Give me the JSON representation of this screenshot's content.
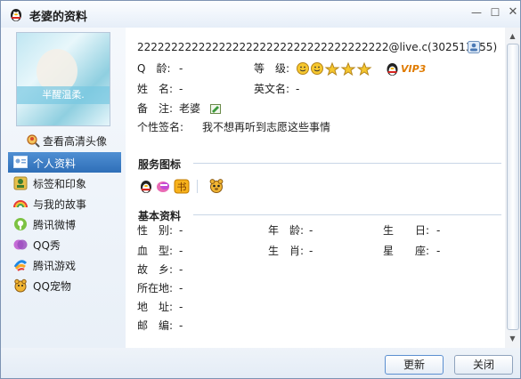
{
  "window": {
    "title": "老婆的资料",
    "min_glyph": "—",
    "max_glyph": "☐",
    "close_glyph": "✕"
  },
  "sidebar": {
    "avatar_banner": "半醒温柔.",
    "hd_avatar_link": "查看高清头像",
    "items": [
      {
        "label": "个人资料",
        "icon": "id-card-icon",
        "active": true
      },
      {
        "label": "标签和印象",
        "icon": "tag-icon",
        "active": false
      },
      {
        "label": "与我的故事",
        "icon": "rainbow-icon",
        "active": false
      },
      {
        "label": "腾讯微博",
        "icon": "weibo-icon",
        "active": false
      },
      {
        "label": "QQ秀",
        "icon": "qqshow-icon",
        "active": false
      },
      {
        "label": "腾讯游戏",
        "icon": "game-icon",
        "active": false
      },
      {
        "label": "QQ宠物",
        "icon": "pet-icon",
        "active": false
      }
    ]
  },
  "profile": {
    "email_line": "2222222222222222222222222222222222222@live.c(302513555)",
    "qq_age_label": "Q　龄:",
    "qq_age_value": "-",
    "level_label": "等　级:",
    "vip_text": "VIP3",
    "name_label": "姓　名:",
    "name_value": "-",
    "english_name_label": "英文名:",
    "english_name_value": "-",
    "remark_label": "备　注:",
    "remark_value": "老婆",
    "signature_label": "个性签名:",
    "signature_value": "我不想再听到志愿这些事情"
  },
  "service_icons": {
    "title": "服务图标"
  },
  "basic": {
    "title": "基本资料",
    "gender_label": "性　别:",
    "gender_value": "-",
    "age_label": "年　龄:",
    "age_value": "-",
    "birthday_label": "生　　日:",
    "birthday_value": "-",
    "blood_label": "血　型:",
    "blood_value": "-",
    "zodiac_label": "生　肖:",
    "zodiac_value": "-",
    "star_label": "星　　座:",
    "star_value": "-",
    "hometown_label": "故　乡:",
    "hometown_value": "-",
    "location_label": "所在地:",
    "location_value": "-",
    "address_label": "地　址:",
    "address_value": "-",
    "postcode_label": "邮　编:",
    "postcode_value": "-"
  },
  "footer": {
    "refresh_label": "更新",
    "close_label": "关闭"
  },
  "colors": {
    "accent": "#2f6fb8",
    "vip": "#e07b00"
  }
}
